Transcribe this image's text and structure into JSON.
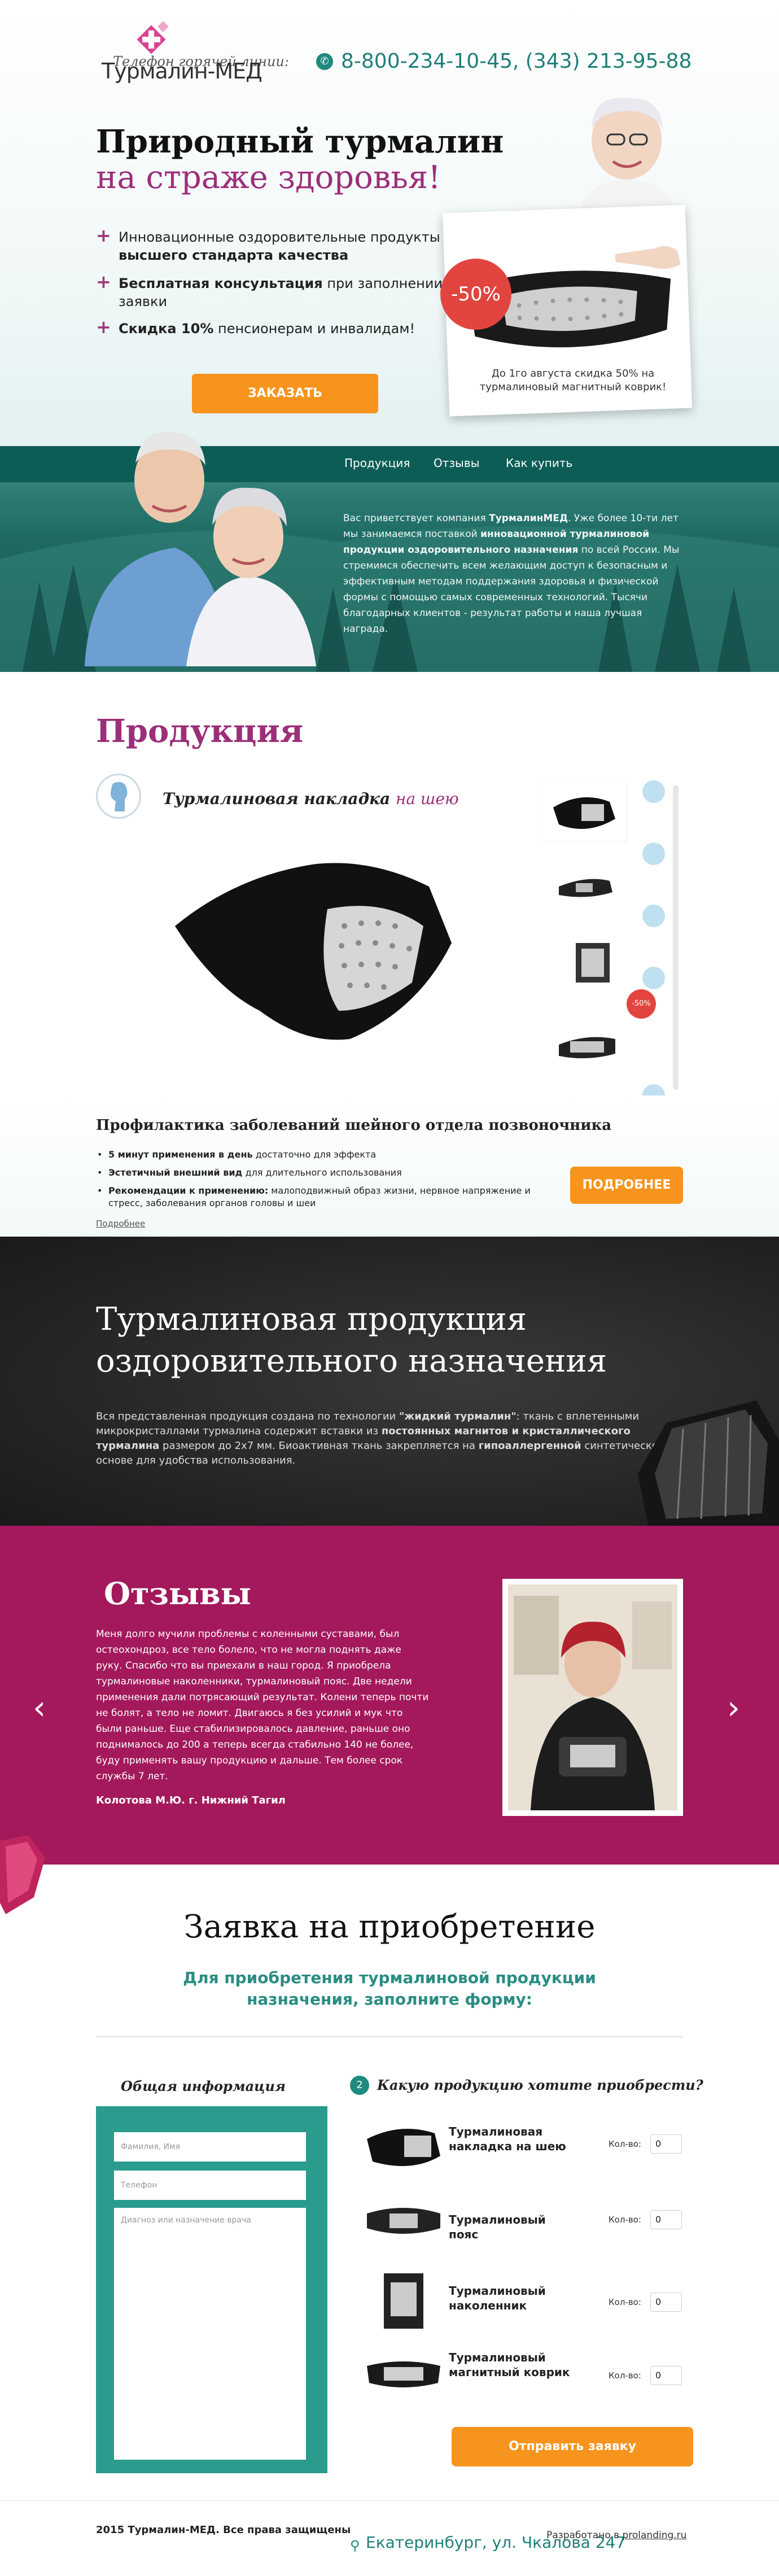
{
  "header": {
    "logo_text": "Турмалин-МЕД",
    "hotline_label": "Телефон горячей линии:",
    "phones": "8-800-234-10-45, (343) 213-95-88"
  },
  "hero": {
    "title_line1": "Природный турмалин",
    "title_line2": "на страже здоровья!",
    "features": [
      {
        "text": "Инновационные оздоровительные продукты",
        "bold": "высшего стандарта качества"
      },
      {
        "bold": "Бесплатная консультация",
        "text": " при заполнении заявки"
      },
      {
        "bold": "Скидка 10%",
        "text": " пенсионерам и инвалидам!"
      }
    ],
    "order_button": "ЗАКАЗАТЬ",
    "promo_badge": "-50%",
    "promo_text": "До 1го августа скидка 50% на турмалиновый магнитный коврик!"
  },
  "nav": {
    "items": [
      "Продукция",
      "Отзывы",
      "Как купить"
    ]
  },
  "about": {
    "text_1": "Вас приветствует компания ",
    "company": "ТурмалинМЕД",
    "text_2": ". Уже более 10-ти лет мы занимаемся поставкой ",
    "bold_2": "инновационной турмалиновой продукции оздоровительного назначения",
    "text_3": " по всей России. Мы стремимся обеспечить всем желающим доступ к безопасным и эффективным методам поддержания здоровья и физической формы с помощью самых современных технологий. Тысячи благодарных клиентов - результат работы и наша лучшая награда."
  },
  "products": {
    "heading": "Продукция",
    "title_main": "Турмалиновая накладка",
    "title_accent": "на шею",
    "thumb_badge": "-50%",
    "desc_heading": "Профилактика заболеваний шейного отдела позвоночника",
    "bullets": [
      {
        "bold": "5 минут применения в день",
        "text": " достаточно для эффекта"
      },
      {
        "bold": "Эстетичный внешний вид",
        "text": " для длительного использования"
      },
      {
        "bold": "Рекомендации к применению:",
        "text": " малоподвижный образ жизни, нервное напряжение и стресс, заболевания органов головы и шеи"
      }
    ],
    "more_link": "Подробнее",
    "more_button": "ПОДРОБНЕЕ"
  },
  "tech": {
    "heading_line1": "Турмалиновая продукция",
    "heading_line2": "оздоровительного назначения",
    "p_1": "Вся представленная продукция создана по технологии ",
    "b_1": "\"жидкий турмалин\"",
    "p_2": ": ткань с вплетенными микрокристаллами турмалина содержит вставки из ",
    "b_2": "постоянных магнитов и кристаллического турмалина",
    "p_3": " размером до 2х7 мм. Биоактивная ткань закрепляется на ",
    "b_3": "гипоаллергенной",
    "p_4": " синтетической основе для удобства использования."
  },
  "reviews": {
    "heading": "Отзывы",
    "text": "Меня долго мучили проблемы с коленными суставами, был остеохондроз, все тело болело, что не могла поднять даже руку. Спасибо что вы приехали в наш город. Я приобрела турмалиновые наколенники, турмалиновый пояс. Две недели применения дали потрясающий результат. Колени теперь почти не болят, а тело не ломит. Двигаюсь я без усилий и мук что были раньше. Еще стабилизировалось давление, раньше оно поднималось до 200 а теперь всегда стабильно 140 не более, буду применять вашу продукцию и дальше. Тем более срок службы 7 лет.",
    "author": "Колотова М.Ю. г. Нижний Тагил",
    "prev": "‹",
    "next": "›"
  },
  "form": {
    "heading": "Заявка на приобретение",
    "subheading": "Для приобретения турмалиновой продукции назначения, заполните форму:",
    "general_heading": "Общая информация",
    "name_placeholder": "Фамилия, Имя",
    "phone_placeholder": "Телефон",
    "diag_placeholder": "Диагноз или назначение врача",
    "step_num": "2",
    "products_heading": "Какую продукцию хотите приобрести?",
    "qty_label": "Кол-во:",
    "items": [
      {
        "name": "Турмалиновая накладка на шею",
        "qty": "0"
      },
      {
        "name": "Турмалиновый пояс",
        "qty": "0"
      },
      {
        "name": "Турмалиновый наколенник",
        "qty": "0"
      },
      {
        "name": "Турмалиновый магнитный коврик",
        "qty": "0"
      }
    ],
    "submit": "Отправить заявку"
  },
  "footer": {
    "copyright": "2015 Турмалин-МЕД. Все права защищены",
    "address": "Екатеринбург, ул. Чкалова 247",
    "dev_prefix": "Разработано в ",
    "dev_link": "prolanding.ru"
  }
}
